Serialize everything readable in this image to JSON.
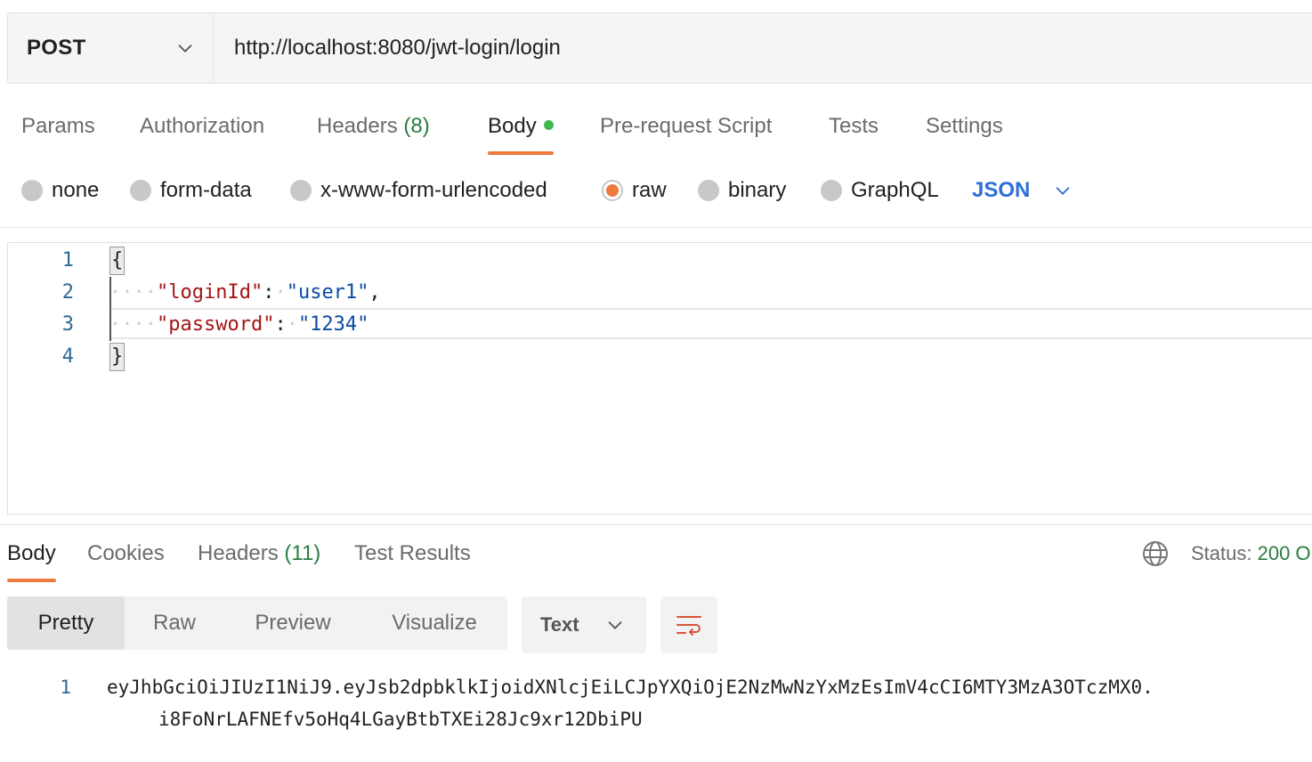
{
  "request": {
    "method": "POST",
    "url": "http://localhost:8080/jwt-login/login"
  },
  "request_tabs": [
    {
      "label": "Params"
    },
    {
      "label": "Authorization"
    },
    {
      "label": "Headers",
      "count": "(8)"
    },
    {
      "label": "Body",
      "active": true
    },
    {
      "label": "Pre-request Script"
    },
    {
      "label": "Tests"
    },
    {
      "label": "Settings"
    }
  ],
  "body_types": [
    {
      "label": "none"
    },
    {
      "label": "form-data"
    },
    {
      "label": "x-www-form-urlencoded"
    },
    {
      "label": "raw",
      "selected": true
    },
    {
      "label": "binary"
    },
    {
      "label": "GraphQL"
    }
  ],
  "raw_format": "JSON",
  "editor": {
    "line_numbers": [
      "1",
      "2",
      "3",
      "4"
    ],
    "open_brace": "{",
    "close_brace": "}",
    "entries": [
      {
        "key": "\"loginId\"",
        "value": "\"user1\"",
        "trailing": ","
      },
      {
        "key": "\"password\"",
        "value": "\"1234\"",
        "trailing": ""
      }
    ]
  },
  "response_tabs": [
    {
      "label": "Body",
      "active": true
    },
    {
      "label": "Cookies"
    },
    {
      "label": "Headers",
      "count": "(11)"
    },
    {
      "label": "Test Results"
    }
  ],
  "status": {
    "label": "Status:",
    "value": "200 O"
  },
  "view_modes": [
    {
      "label": "Pretty",
      "active": true
    },
    {
      "label": "Raw"
    },
    {
      "label": "Preview"
    },
    {
      "label": "Visualize"
    }
  ],
  "response_format": "Text",
  "response_body": {
    "line_number": "1",
    "line1": "eyJhbGciOiJIUzI1NiJ9.eyJsb2dpbklkIjoidXNlcjEiLCJpYXQiOjE2NzMwNzYxMzEsImV4cCI6MTY3MzA3OTczMX0.",
    "line2": "i8FoNrLAFNEfv5oHq4LGayBtbTXEi28Jc9xr12DbiPU"
  },
  "colors": {
    "accent": "#ee7a3e",
    "link": "#2d6fd6",
    "success": "#2a7d3f",
    "dot": "#3fb950"
  },
  "icons": [
    "chevron-down-icon",
    "globe-icon",
    "wrap-lines-icon"
  ]
}
